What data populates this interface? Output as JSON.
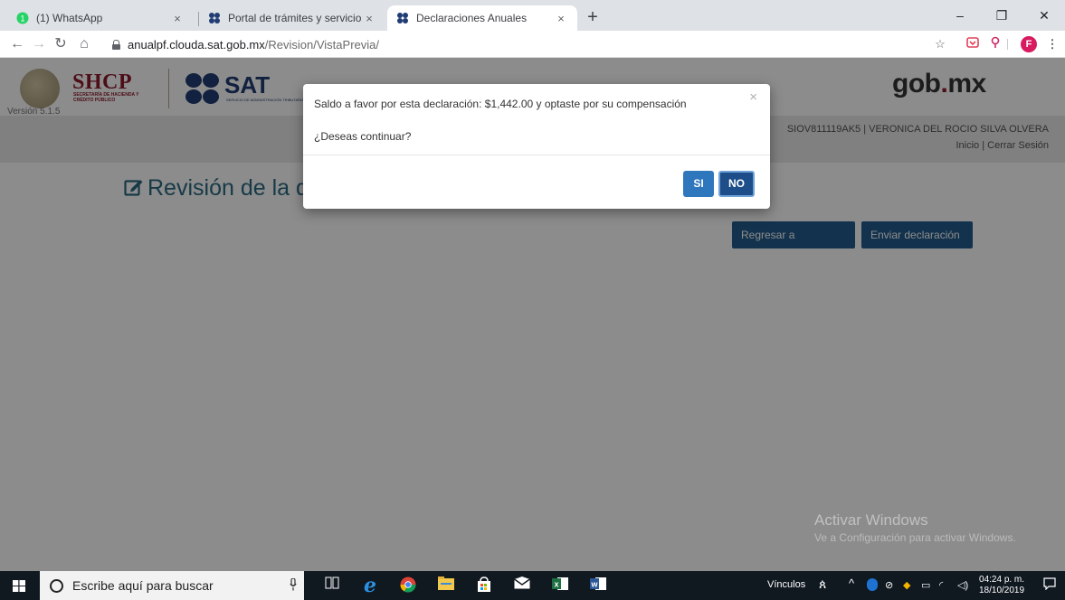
{
  "browser": {
    "tabs": [
      {
        "label": "(1) WhatsApp",
        "close": "×"
      },
      {
        "label": "Portal de trámites y servicios - SA",
        "close": "×"
      },
      {
        "label": "Declaraciones Anuales",
        "close": "×"
      }
    ],
    "new_tab": "+",
    "window_controls": {
      "minimize": "–",
      "restore": "❐",
      "close": "✕"
    },
    "url_host": "anualpf.clouda.sat.gob.mx",
    "url_path": "/Revision/VistaPrevia/",
    "profile_initial": "F"
  },
  "header": {
    "shcp": "SHCP",
    "shcp_sub": "SECRETARÍA DE HACIENDA Y CRÉDITO PÚBLICO",
    "version": "Versión 5.1.5",
    "sat": "SAT",
    "sat_sub": "SERVICIO DE ADMINISTRACIÓN TRIBUTARIA",
    "gob": "gob",
    "gob_dot": ".",
    "gob_mx": "mx",
    "user": "SIOV811119AK5 | VERONICA DEL ROCIO SILVA OLVERA",
    "link_inicio": "Inicio",
    "link_sep": " | ",
    "link_cerrar": "Cerrar Sesión"
  },
  "main": {
    "title": "Revisión de la d",
    "btn_regresar": "Regresar a formulario",
    "btn_enviar": "Enviar declaración"
  },
  "modal": {
    "message": "Saldo a favor por esta declaración: $1,442.00 y optaste por su compensación",
    "question": "¿Deseas continuar?",
    "close": "×",
    "btn_si": "SI",
    "btn_no": "NO"
  },
  "watermark": {
    "line1": "Activar Windows",
    "line2": "Ve a Configuración para activar Windows."
  },
  "taskbar": {
    "search_placeholder": "Escribe aquí para buscar",
    "vinculos": "Vínculos",
    "time": "04:24 p. m.",
    "date": "18/10/2019"
  },
  "colors": {
    "accent_blue": "#245c8c",
    "no_button": "#1d4e89",
    "si_button": "#2f77bd",
    "title_teal": "#2a6b82",
    "shcp_maroon": "#8d1b2c"
  }
}
